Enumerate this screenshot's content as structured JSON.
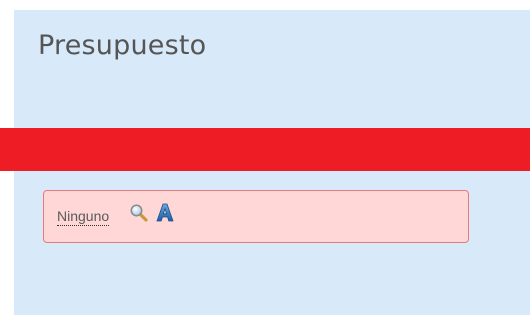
{
  "header": {
    "title": "Presupuesto"
  },
  "field": {
    "value": "Ninguno",
    "icons": [
      "magnifier-icon",
      "letter-a-icon"
    ]
  },
  "colors": {
    "panel_background": "#d8e9f9",
    "alert_bar": "#ee1c25",
    "field_background": "#ffd7d7",
    "field_border": "#e8797b"
  }
}
